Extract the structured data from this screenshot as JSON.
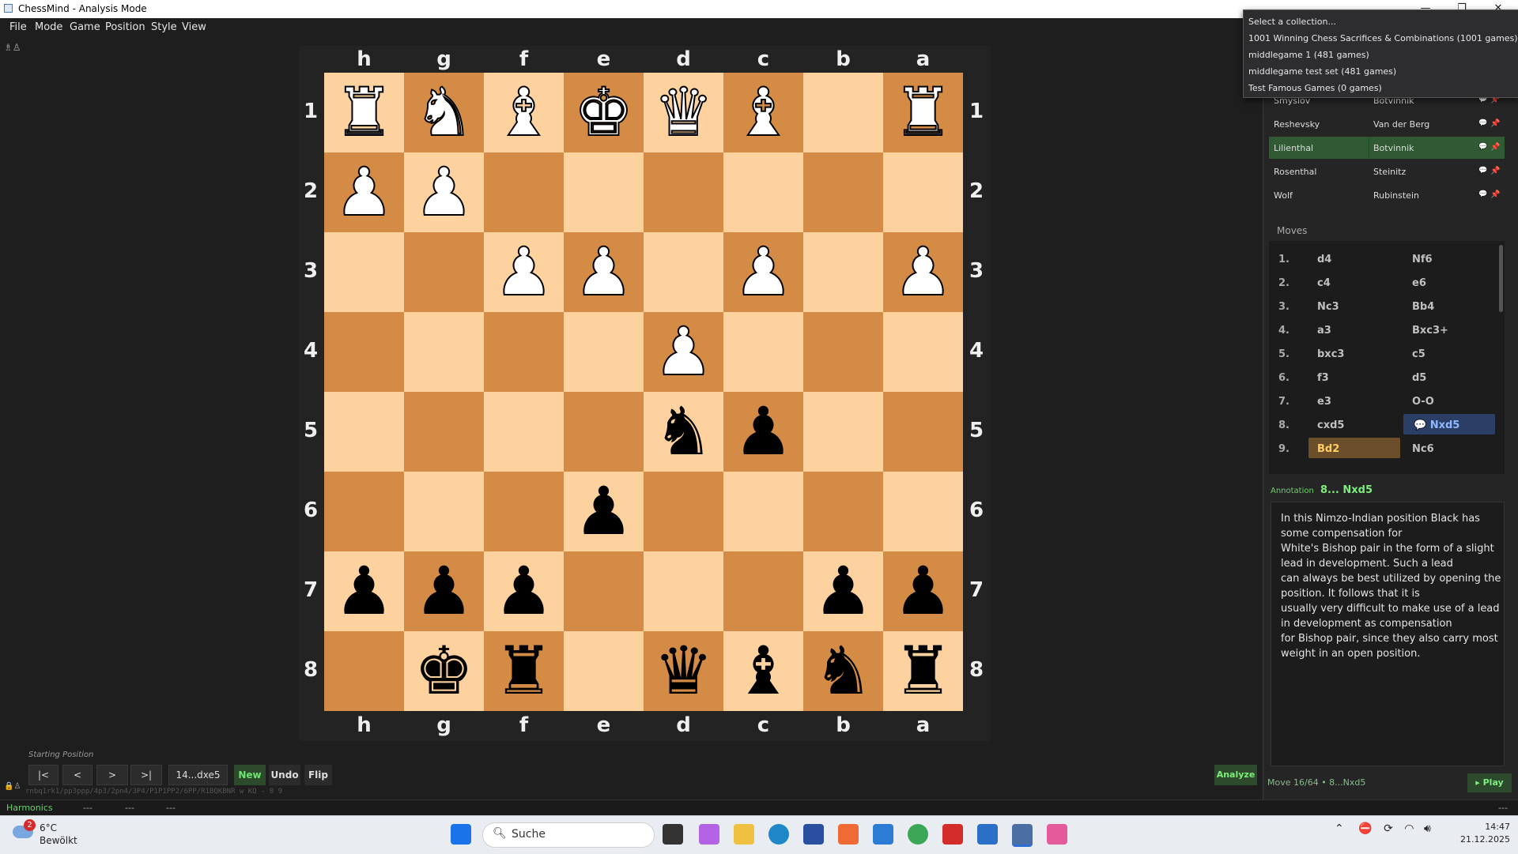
{
  "window": {
    "title": "ChessMind - Analysis Mode",
    "minimize": "—",
    "maximize": "❐",
    "close": "✕"
  },
  "menu": [
    "File",
    "Mode",
    "Game",
    "Position",
    "Style",
    "View"
  ],
  "toolbar_glyphs": "♗♙",
  "board": {
    "files": [
      "h",
      "g",
      "f",
      "e",
      "d",
      "c",
      "b",
      "a"
    ],
    "ranks": [
      "1",
      "2",
      "3",
      "4",
      "5",
      "6",
      "7",
      "8"
    ],
    "light_color": "#fdd29e",
    "dark_color": "#d48b45",
    "squares": [
      [
        "wR",
        "wN",
        "wB",
        "wK",
        "wQ",
        "wB",
        "",
        "wR"
      ],
      [
        "wP",
        "wP",
        "",
        "",
        "",
        "",
        "",
        ""
      ],
      [
        "",
        "",
        "wP",
        "wP",
        "",
        "wP",
        "",
        "wP"
      ],
      [
        "",
        "",
        "",
        "",
        "wP",
        "",
        "",
        ""
      ],
      [
        "",
        "",
        "",
        "",
        "bN",
        "bP",
        "",
        ""
      ],
      [
        "",
        "",
        "",
        "bP",
        "",
        "",
        "",
        ""
      ],
      [
        "bP",
        "bP",
        "bP",
        "",
        "",
        "",
        "bP",
        "bP"
      ],
      [
        "",
        "bK",
        "bR",
        "",
        "bQ",
        "bB",
        "bN",
        "bR"
      ]
    ]
  },
  "controls": {
    "starting_position": "Starting Position",
    "first": "|<",
    "prev": "<",
    "next": ">",
    "last": ">|",
    "current_move": "14...dxe5",
    "new": "New",
    "undo": "Undo",
    "flip": "Flip",
    "analyze": "Analyze",
    "fen": "rnbq1rk1/pp3ppp/4p3/2pn4/3P4/P1P1PP2/6PP/R1BQKBNR w KQ - 0 9"
  },
  "statusbar": {
    "engine": "Harmonics",
    "field1": "---",
    "field2": "---",
    "field3": "---",
    "right": "---"
  },
  "collections_dropdown": {
    "placeholder": "Select a collection...",
    "options": [
      "1001 Winning Chess Sacrifices & Combinations (1001 games)",
      "middlegame 1 (481 games)",
      "middlegame test set (481 games)",
      "Test Famous Games (0 games)"
    ]
  },
  "games": [
    {
      "white": "Smyslov",
      "black": "Botvinnik"
    },
    {
      "white": "Reshevsky",
      "black": "Van der Berg"
    },
    {
      "white": "Lilienthal",
      "black": "Botvinnik"
    },
    {
      "white": "Rosenthal",
      "black": "Steinitz"
    },
    {
      "white": "Wolf",
      "black": "Rubinstein"
    }
  ],
  "moves_label": "Moves",
  "moves": [
    {
      "n": "1.",
      "w": "d4",
      "b": "Nf6"
    },
    {
      "n": "2.",
      "w": "c4",
      "b": "e6"
    },
    {
      "n": "3.",
      "w": "Nc3",
      "b": "Bb4"
    },
    {
      "n": "4.",
      "w": "a3",
      "b": "Bxc3+"
    },
    {
      "n": "5.",
      "w": "bxc3",
      "b": "c5"
    },
    {
      "n": "6.",
      "w": "f3",
      "b": "d5"
    },
    {
      "n": "7.",
      "w": "e3",
      "b": "O-O"
    },
    {
      "n": "8.",
      "w": "cxd5",
      "b": "💬 Nxd5"
    },
    {
      "n": "9.",
      "w": "Bd2",
      "b": "Nc6"
    }
  ],
  "annotation": {
    "label": "Annotation",
    "move": "8... Nxd5",
    "text": "In this Nimzo-Indian position Black has some compensation for\nWhite's Bishop pair in the form of a slight lead in development. Such a lead\ncan always be best utilized by opening the position. It follows that it is\nusually very difficult to make use of a lead in development as compensation\nfor Bishop pair, since they also carry most weight in an open position."
  },
  "move_status": "Move 16/64 • 8...Nxd5",
  "play": "▸ Play",
  "taskbar": {
    "weather_temp": "6°C",
    "weather_desc": "Bewölkt",
    "weather_badge": "2",
    "search_placeholder": "Suche",
    "time": "14:47",
    "date": "21.12.2025"
  }
}
